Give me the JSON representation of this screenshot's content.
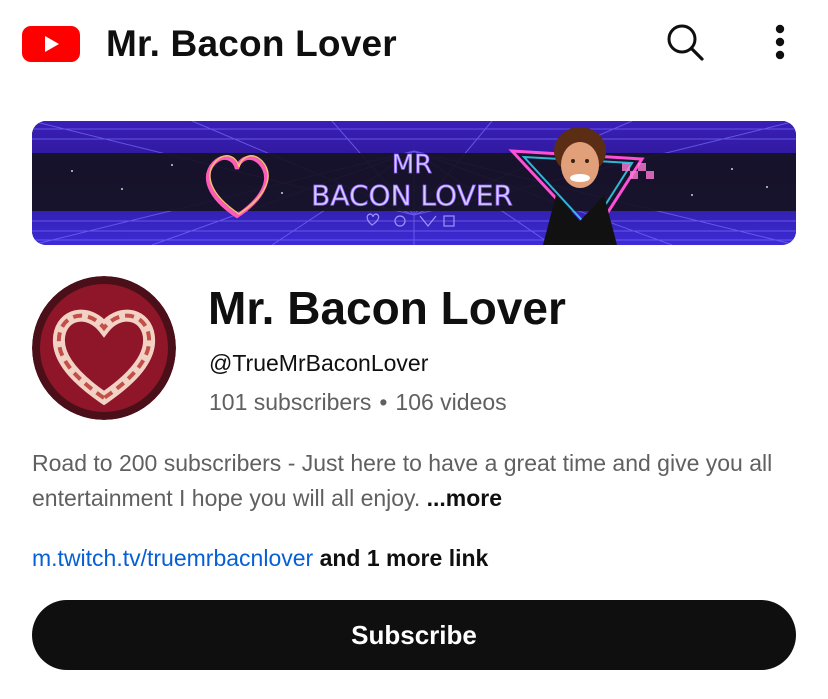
{
  "app": {
    "title": "Mr. Bacon Lover",
    "logo_icon": "youtube-logo-icon",
    "search_icon": "search-icon",
    "menu_icon": "more-vert-icon"
  },
  "banner": {
    "text_line1": "MR",
    "text_line2": "BACON LOVER"
  },
  "channel": {
    "name": "Mr. Bacon Lover",
    "handle": "@TrueMrBaconLover",
    "subscribers": "101 subscribers",
    "separator": "•",
    "videos": "106 videos",
    "description": "Road to 200 subscribers - Just here to have a great time and give you all entertainment I hope you will all enjoy. ",
    "more_label": "...more",
    "link": "m.twitch.tv/truemrbacnlover",
    "more_links": " and 1 more link"
  },
  "actions": {
    "subscribe_label": "Subscribe"
  },
  "colors": {
    "brand_red": "#ff0000",
    "link_blue": "#065fd4",
    "secondary_text": "#606060",
    "button_black": "#0f0f0f"
  }
}
